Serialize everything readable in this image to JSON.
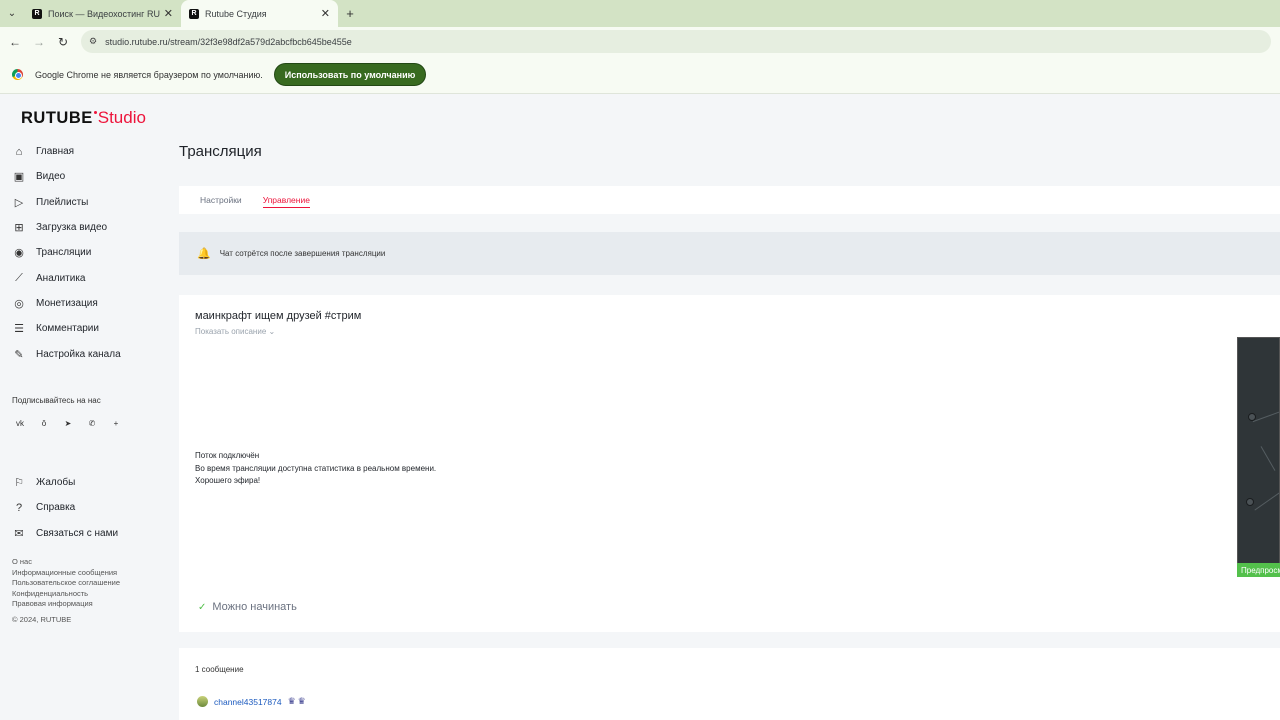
{
  "browser": {
    "tabs": [
      {
        "label": "Поиск — Видеохостинг RUTUBE",
        "active": false
      },
      {
        "label": "Rutube Студия",
        "active": true
      }
    ],
    "url": "studio.rutube.ru/stream/32f3e98df2a579d2abcfbcb645be455e",
    "infobar_text": "Google Chrome не является браузером по умолчанию.",
    "infobar_button": "Использовать по умолчанию"
  },
  "logo": {
    "brand": "RUTUBE",
    "product": "Studio"
  },
  "sidebar": {
    "items": [
      {
        "label": "Главная",
        "icon": "home-icon"
      },
      {
        "label": "Видео",
        "icon": "video-icon"
      },
      {
        "label": "Плейлисты",
        "icon": "playlist-icon"
      },
      {
        "label": "Загрузка видео",
        "icon": "upload-icon"
      },
      {
        "label": "Трансляции",
        "icon": "broadcast-icon"
      },
      {
        "label": "Аналитика",
        "icon": "analytics-icon"
      },
      {
        "label": "Монетизация",
        "icon": "coin-icon"
      },
      {
        "label": "Комментарии",
        "icon": "comments-icon"
      },
      {
        "label": "Настройка канала",
        "icon": "wand-icon"
      }
    ],
    "subscribe_label": "Подписывайтесь на нас",
    "social": [
      "vk-icon",
      "ok-icon",
      "telegram-icon",
      "viber-icon",
      "plus-icon"
    ],
    "items2": [
      {
        "label": "Жалобы",
        "icon": "flag-icon"
      },
      {
        "label": "Справка",
        "icon": "help-icon"
      },
      {
        "label": "Связаться с нами",
        "icon": "chat-icon"
      }
    ],
    "footer_links": [
      "О нас",
      "Информационные сообщения",
      "Пользовательское соглашение",
      "Конфиденциальность",
      "Правовая информация"
    ],
    "copyright": "© 2024, RUTUBE"
  },
  "main": {
    "title": "Трансляция",
    "tabs": [
      {
        "label": "Настройки",
        "active": false
      },
      {
        "label": "Управление",
        "active": true
      }
    ],
    "notice": "Чат сотрётся после завершения трансляции",
    "stream_title": "маинкрафт ищем друзей #стрим",
    "show_description": "Показать описание",
    "status_lines": [
      "Поток подключён",
      "Во время трансляции доступна статистика в реальном времени.",
      "Хорошего эфира!"
    ],
    "preview_label": "Предпросмотр",
    "ready_label": "Можно начинать",
    "message_count": "1 сообщение",
    "message_user": "channel43517874"
  },
  "colors": {
    "accent": "#ed143b",
    "default_button": "#386a20",
    "ready_check": "#53c04b",
    "chat_user": "#1d5bbf"
  }
}
